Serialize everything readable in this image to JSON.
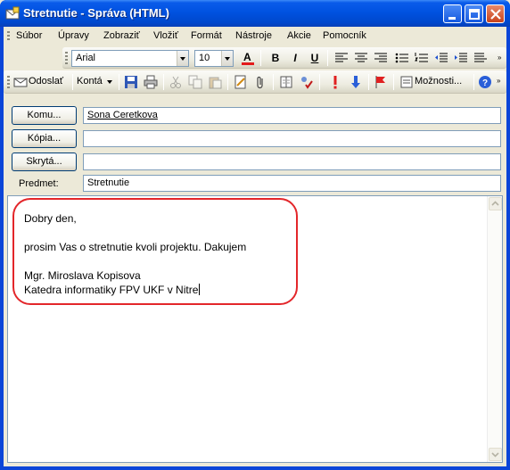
{
  "window": {
    "title": "Stretnutie - Správa (HTML)"
  },
  "menu": {
    "items": [
      "Súbor",
      "Úpravy",
      "Zobraziť",
      "Vložiť",
      "Formát",
      "Nástroje",
      "Akcie",
      "Pomocník"
    ]
  },
  "format_toolbar": {
    "font": "Arial",
    "size": "10",
    "bold": "B",
    "italic": "I",
    "underline": "U"
  },
  "standard_toolbar": {
    "send_label": "Odoslať",
    "accounts_label": "Kontá",
    "options_label": "Možnosti..."
  },
  "fields": {
    "to_button": "Komu...",
    "to_value": "Sona Ceretkova",
    "cc_button": "Kópia...",
    "cc_value": "",
    "bcc_button": "Skrytá...",
    "bcc_value": "",
    "subject_label": "Predmet:",
    "subject_value": "Stretnutie"
  },
  "message": {
    "lines": [
      "Dobry den,",
      "prosim Vas o stretnutie kvoli projektu. Dakujem",
      "Mgr. Miroslava Kopisova",
      "Katedra informatiky FPV UKF v Nitre"
    ]
  },
  "colors": {
    "title_bar": "#0052e0",
    "highlight": "#e3262a"
  }
}
